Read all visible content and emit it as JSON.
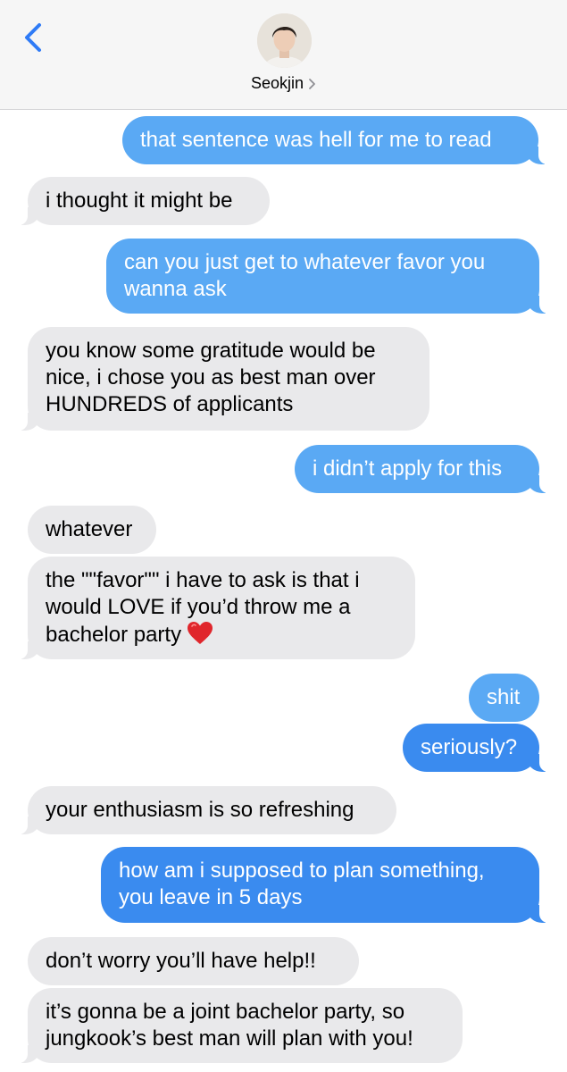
{
  "header": {
    "contact_name": "Seokjin",
    "back_icon": "chevron-left-icon",
    "detail_icon": "chevron-right-icon",
    "accent_color": "#2f7bf6"
  },
  "colors": {
    "incoming_bubble": "#e9e9eb",
    "outgoing_bubble": "#5aa9f4",
    "outgoing_bubble_dark": "#3a8bef"
  },
  "messages": [
    {
      "from": "me",
      "lines": [
        "that sentence was hell for me to read"
      ]
    },
    {
      "from": "them",
      "lines": [
        "i thought it might be"
      ]
    },
    {
      "from": "me",
      "lines": [
        "can you just get to whatever favor you",
        "wanna ask"
      ]
    },
    {
      "from": "them",
      "lines": [
        "you know some gratitude would be",
        "nice, i chose you as best man over",
        "HUNDREDS of applicants"
      ]
    },
    {
      "from": "me",
      "lines": [
        "i didn’t apply for this"
      ]
    },
    {
      "from": "them",
      "lines": [
        "whatever"
      ]
    },
    {
      "from": "them",
      "lines": [
        "the \"\"favor\"\" i have to ask is that i",
        "would LOVE if you’d throw me a",
        "bachelor party"
      ],
      "emoji": "heart-emoji"
    },
    {
      "from": "me",
      "lines": [
        "shit"
      ]
    },
    {
      "from": "me",
      "lines": [
        "seriously?"
      ]
    },
    {
      "from": "them",
      "lines": [
        "your enthusiasm is so refreshing"
      ]
    },
    {
      "from": "me",
      "lines": [
        "how am i supposed to plan something,",
        "you leave in 5 days"
      ]
    },
    {
      "from": "them",
      "lines": [
        "don’t worry you’ll have help!!"
      ]
    },
    {
      "from": "them",
      "lines": [
        "it’s gonna be a joint bachelor party, so",
        "jungkook’s best man will plan with you!"
      ]
    }
  ]
}
